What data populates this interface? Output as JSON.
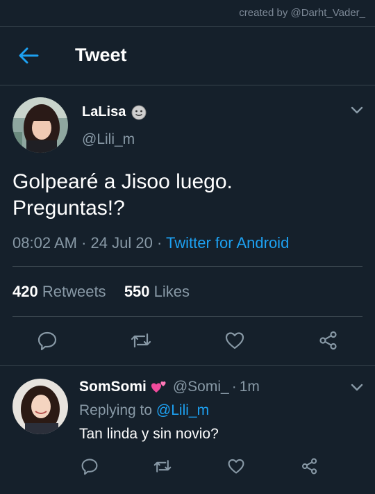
{
  "credit": "created by @Darht_Vader_",
  "header": {
    "title": "Tweet"
  },
  "tweet": {
    "name": "LaLisa",
    "handle": "@Lili_m",
    "text_line1": "Golpearé a Jisoo luego.",
    "text_line2": "Preguntas!?",
    "time": "08:02 AM",
    "dot1": "·",
    "date": "24 Jul 20",
    "dot2": "·",
    "app": "Twitter for Android",
    "retweet_count": "420",
    "retweet_label": "Retweets",
    "like_count": "550",
    "like_label": "Likes"
  },
  "reply": {
    "name": "SomSomi",
    "handle": "@Somi_",
    "dot": "·",
    "age": "1m",
    "replying_prefix": "Replying to",
    "replying_to": "@Lili_m",
    "text": "Tan linda y sin novio?"
  },
  "icons": {
    "back": "arrow-left-icon",
    "chevron": "chevron-down-icon",
    "reply": "comment-icon",
    "retweet": "retweet-icon",
    "like": "heart-icon",
    "share": "share-icon"
  },
  "colors": {
    "background": "#15202b",
    "accent": "#1da1f2",
    "secondary_text": "#8899a6",
    "divider": "#38444d"
  }
}
